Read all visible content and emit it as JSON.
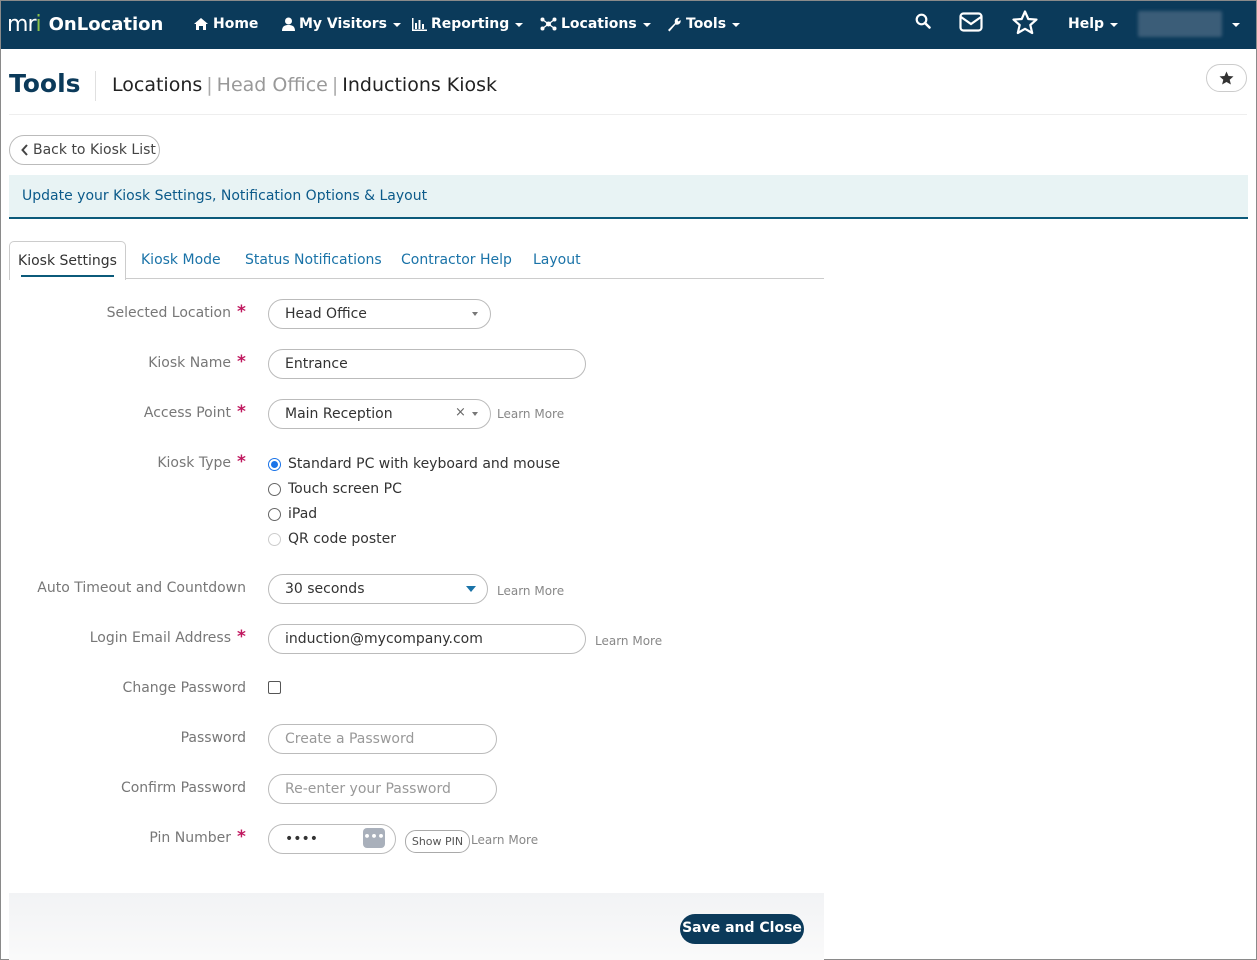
{
  "nav": {
    "brand_logo": "mri",
    "brand_name": "OnLocation",
    "items": [
      {
        "label": "Home",
        "icon": "home-icon"
      },
      {
        "label": "My Visitors",
        "icon": "user-icon"
      },
      {
        "label": "Reporting",
        "icon": "bar-chart-icon"
      },
      {
        "label": "Locations",
        "icon": "sitemap-icon"
      },
      {
        "label": "Tools",
        "icon": "wrench-icon"
      }
    ],
    "help_label": "Help",
    "icons": [
      "search-icon",
      "envelope-icon",
      "star-icon"
    ],
    "bg_color": "#0b3a5a"
  },
  "header": {
    "title": "Tools",
    "breadcrumb": [
      "Locations",
      "Head Office",
      "Inductions Kiosk"
    ],
    "separator": "|"
  },
  "back_label": "Back to Kiosk List",
  "info_text": "Update your Kiosk Settings, Notification Options & Layout",
  "tabs": [
    "Kiosk Settings",
    "Kiosk Mode",
    "Status Notifications",
    "Contractor Help",
    "Layout"
  ],
  "active_tab": "Kiosk Settings",
  "required_mark": "*",
  "learn_more": "Learn More",
  "form": {
    "location_label": "Selected Location",
    "location_value": "Head Office",
    "kiosk_name_label": "Kiosk Name",
    "kiosk_name_value": "Entrance",
    "access_point_label": "Access Point",
    "access_point_value": "Main Reception",
    "clear_mark": "×",
    "kiosk_type_label": "Kiosk Type",
    "kiosk_types": [
      "Standard PC with keyboard and mouse",
      "Touch screen PC",
      "iPad",
      "QR code poster"
    ],
    "kiosk_type_selected": "Standard PC with keyboard and mouse",
    "timeout_label": "Auto Timeout and Countdown",
    "timeout_value": "30 seconds",
    "email_label": "Login Email Address",
    "email_value": "induction@mycompany.com",
    "change_password_label": "Change Password",
    "change_password_checked": false,
    "password_label": "Password",
    "password_placeholder": "Create a Password",
    "confirm_label": "Confirm Password",
    "confirm_placeholder": "Re-enter your Password",
    "pin_label": "Pin Number",
    "pin_value": "••••",
    "pin_icon_text": "•••",
    "show_pin_label": "Show PIN"
  },
  "save_label": "Save and Close",
  "accent_color": "#1a73a8",
  "required_color": "#c0185f"
}
